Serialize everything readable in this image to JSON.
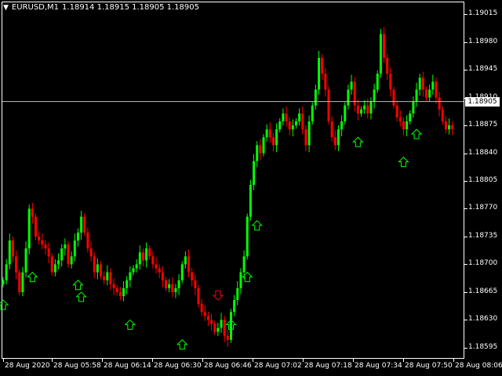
{
  "header": {
    "symbol": "EURUSD,M1",
    "ohlc": "1.18914 1.18915 1.18905 1.18905"
  },
  "price_axis": {
    "ticks": [
      "1.19015",
      "1.18980",
      "1.18945",
      "1.18910",
      "1.18875",
      "1.18840",
      "1.18805",
      "1.18770",
      "1.18735",
      "1.18700",
      "1.18665",
      "1.18630",
      "1.18595"
    ],
    "current_price": "1.18905"
  },
  "time_axis": {
    "labels": [
      "28 Aug 2020",
      "28 Aug 05:58",
      "28 Aug 06:14",
      "28 Aug 06:30",
      "28 Aug 06:46",
      "28 Aug 07:02",
      "28 Aug 07:18",
      "28 Aug 07:34",
      "28 Aug 07:50",
      "28 Aug 08:06"
    ]
  },
  "colors": {
    "background": "#000000",
    "bull": "#00ff00",
    "bear": "#ff0000",
    "grid_line": "#c0c0c0",
    "text": "#ffffff"
  },
  "chart_data": {
    "type": "candlestick",
    "ylim": [
      1.18588,
      1.19022
    ],
    "current_price": 1.18905,
    "closes": [
      1.1868,
      1.187,
      1.1873,
      1.1871,
      1.1869,
      1.18665,
      1.1869,
      1.1872,
      1.1877,
      1.1876,
      1.18735,
      1.1873,
      1.18725,
      1.1872,
      1.1871,
      1.1869,
      1.187,
      1.18705,
      1.1872,
      1.18725,
      1.187,
      1.1871,
      1.1873,
      1.1874,
      1.1876,
      1.1874,
      1.1872,
      1.1871,
      1.1869,
      1.187,
      1.18685,
      1.1868,
      1.1869,
      1.18675,
      1.1867,
      1.18665,
      1.1866,
      1.1867,
      1.1868,
      1.1869,
      1.18695,
      1.187,
      1.18715,
      1.18705,
      1.1872,
      1.1871,
      1.187,
      1.18695,
      1.1869,
      1.1868,
      1.1867,
      1.18675,
      1.18665,
      1.1867,
      1.1868,
      1.187,
      1.1871,
      1.1869,
      1.1868,
      1.1867,
      1.1865,
      1.1864,
      1.18635,
      1.1863,
      1.18625,
      1.18615,
      1.1862,
      1.1863,
      1.1861,
      1.18605,
      1.1864,
      1.18655,
      1.1867,
      1.1869,
      1.1871,
      1.1876,
      1.188,
      1.1883,
      1.1885,
      1.1884,
      1.1886,
      1.1887,
      1.1886,
      1.1885,
      1.1887,
      1.1888,
      1.1889,
      1.1888,
      1.1887,
      1.18875,
      1.1888,
      1.1889,
      1.1887,
      1.1885,
      1.1888,
      1.189,
      1.1892,
      1.1896,
      1.1894,
      1.1892,
      1.1888,
      1.1886,
      1.1885,
      1.1887,
      1.1888,
      1.189,
      1.1892,
      1.1893,
      1.189,
      1.1889,
      1.18895,
      1.189,
      1.1889,
      1.18905,
      1.1892,
      1.1894,
      1.1899,
      1.1896,
      1.1894,
      1.1892,
      1.189,
      1.18885,
      1.1888,
      1.1887,
      1.1888,
      1.1889,
      1.18905,
      1.1892,
      1.18935,
      1.1892,
      1.1891,
      1.1892,
      1.1893,
      1.1891,
      1.18895,
      1.1888,
      1.1887,
      1.18875,
      1.1887
    ],
    "markers": [
      {
        "type": "up",
        "price": 1.18655,
        "index": 0
      },
      {
        "type": "up",
        "price": 1.1869,
        "index": 9
      },
      {
        "type": "up",
        "price": 1.1868,
        "index": 23
      },
      {
        "type": "up",
        "price": 1.18665,
        "index": 24
      },
      {
        "type": "up",
        "price": 1.1863,
        "index": 39
      },
      {
        "type": "up",
        "price": 1.18605,
        "index": 55
      },
      {
        "type": "down",
        "price": 1.18655,
        "index": 66
      },
      {
        "type": "up",
        "price": 1.1863,
        "index": 70
      },
      {
        "type": "up",
        "price": 1.1869,
        "index": 75
      },
      {
        "type": "up",
        "price": 1.18755,
        "index": 78
      },
      {
        "type": "up",
        "price": 1.1886,
        "index": 109
      },
      {
        "type": "up",
        "price": 1.18835,
        "index": 123
      },
      {
        "type": "up",
        "price": 1.1887,
        "index": 127
      }
    ]
  }
}
